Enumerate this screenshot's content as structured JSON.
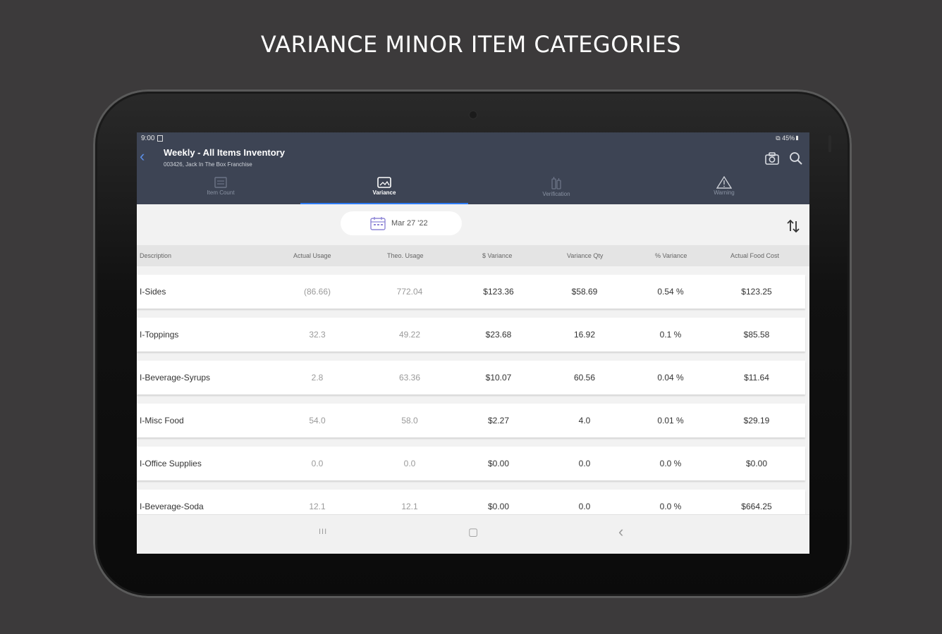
{
  "headline": "VARIANCE MINOR ITEM CATEGORIES",
  "status_bar": {
    "time": "9:00",
    "right": "⧉ 45%▮"
  },
  "app_bar": {
    "title": "Weekly - All Items Inventory",
    "subtitle": "003426, Jack In The Box Franchise"
  },
  "tabs": [
    {
      "label": "Item Count",
      "icon": "clipboard-icon",
      "active": false
    },
    {
      "label": "Variance",
      "icon": "image-frame-icon",
      "active": true
    },
    {
      "label": "Verification",
      "icon": "bottles-icon",
      "active": false
    },
    {
      "label": "Warning",
      "icon": "warning-icon",
      "active": false
    }
  ],
  "date_filter": {
    "label": "Mar 27 '22",
    "icon": "calendar-icon"
  },
  "columns": [
    "Description",
    "Actual Usage",
    "Theo. Usage",
    "$ Variance",
    "Variance Qty",
    "% Variance",
    "Actual Food Cost"
  ],
  "rows": [
    [
      "I-Sides",
      "(86.66)",
      "772.04",
      "$123.36",
      "$58.69",
      "0.54 %",
      "$123.25"
    ],
    [
      "I-Toppings",
      "32.3",
      "49.22",
      "$23.68",
      "16.92",
      "0.1 %",
      "$85.58"
    ],
    [
      "I-Beverage-Syrups",
      "2.8",
      "63.36",
      "$10.07",
      "60.56",
      "0.04 %",
      "$11.64"
    ],
    [
      "I-Misc Food",
      "54.0",
      "58.0",
      "$2.27",
      "4.0",
      "0.01 %",
      "$29.19"
    ],
    [
      "I-Office Supplies",
      "0.0",
      "0.0",
      "$0.00",
      "0.0",
      "0.0 %",
      "$0.00"
    ],
    [
      "I-Beverage-Soda",
      "12.1",
      "12.1",
      "$0.00",
      "0.0",
      "0.0 %",
      "$664.25"
    ]
  ],
  "nav_bar": {
    "recents": "III",
    "home": "▢",
    "back": "‹"
  },
  "colors": {
    "app_bar": "#3d4454",
    "accent": "#2f7cf6",
    "background": "#3c3a3b"
  }
}
